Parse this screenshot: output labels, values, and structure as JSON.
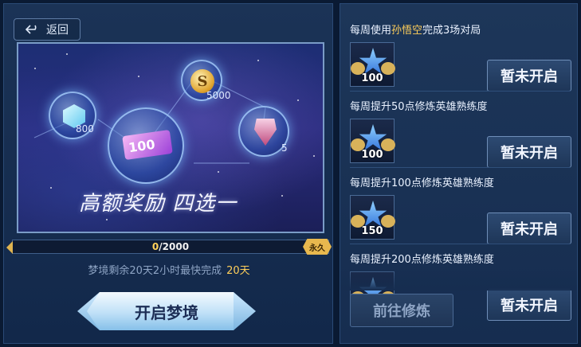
{
  "header": {
    "back_label": "返回"
  },
  "banner": {
    "rewards": [
      {
        "icon": "crystal-icon",
        "count": "800"
      },
      {
        "icon": "coin-icon",
        "count": "5000"
      },
      {
        "icon": "ticket-icon",
        "count": "100"
      },
      {
        "icon": "card-icon",
        "count": "5"
      }
    ],
    "tagline": "高额奖励 四选一"
  },
  "progress": {
    "current": "0",
    "total": "/2000",
    "fraction": 0.0,
    "badge": "永久"
  },
  "remaining": {
    "text": "梦境剩余20天2小时最快完成",
    "days": "20天"
  },
  "start_button": "开启梦境",
  "tasks": [
    {
      "title_pre": "每周使用",
      "title_hl": "孙悟空",
      "title_post": "完成3场对局",
      "reward": "100",
      "button": "暂未开启"
    },
    {
      "title_pre": "每周提升50点修炼英雄熟练度",
      "title_hl": "",
      "title_post": "",
      "reward": "100",
      "button": "暂未开启"
    },
    {
      "title_pre": "每周提升100点修炼英雄熟练度",
      "title_hl": "",
      "title_post": "",
      "reward": "150",
      "button": "暂未开启"
    },
    {
      "title_pre": "每周提升200点修炼英雄熟练度",
      "title_hl": "",
      "title_post": "",
      "reward": "",
      "button": "暂未开启"
    }
  ],
  "goto_button": "前往修炼",
  "colors": {
    "accent_gold": "#ffcf5a",
    "panel": "#1b3356",
    "button_light": "#bfe0f7"
  }
}
